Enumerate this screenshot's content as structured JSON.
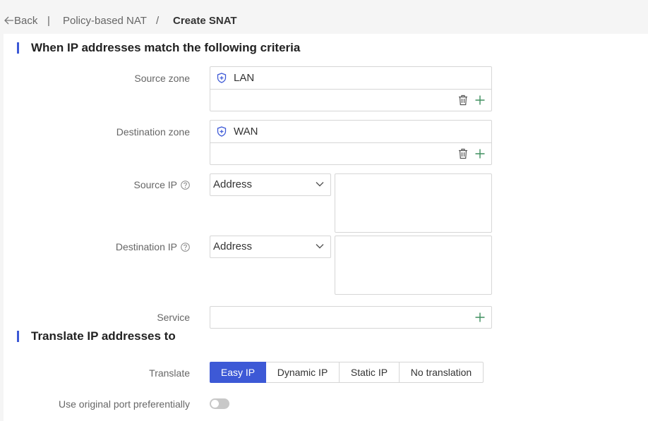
{
  "breadcrumb": {
    "back_label": "Back",
    "separator1": "|",
    "parent": "Policy-based NAT",
    "separator2": "/",
    "current": "Create SNAT"
  },
  "criteria_section": {
    "title": "When IP addresses match the following criteria",
    "source_zone": {
      "label": "Source zone",
      "value": "LAN"
    },
    "destination_zone": {
      "label": "Destination zone",
      "value": "WAN"
    },
    "source_ip": {
      "label": "Source IP",
      "type_value": "Address"
    },
    "destination_ip": {
      "label": "Destination IP",
      "type_value": "Address"
    },
    "service": {
      "label": "Service"
    }
  },
  "translate_section": {
    "title": "Translate IP addresses to",
    "translate_label": "Translate",
    "options": [
      "Easy IP",
      "Dynamic IP",
      "Static IP",
      "No translation"
    ],
    "selected": "Easy IP",
    "original_port": {
      "label": "Use original port preferentially",
      "enabled": false
    }
  },
  "colors": {
    "accent": "#3d59d6",
    "plus": "#3f8f5f",
    "border": "#d6d6d6"
  }
}
